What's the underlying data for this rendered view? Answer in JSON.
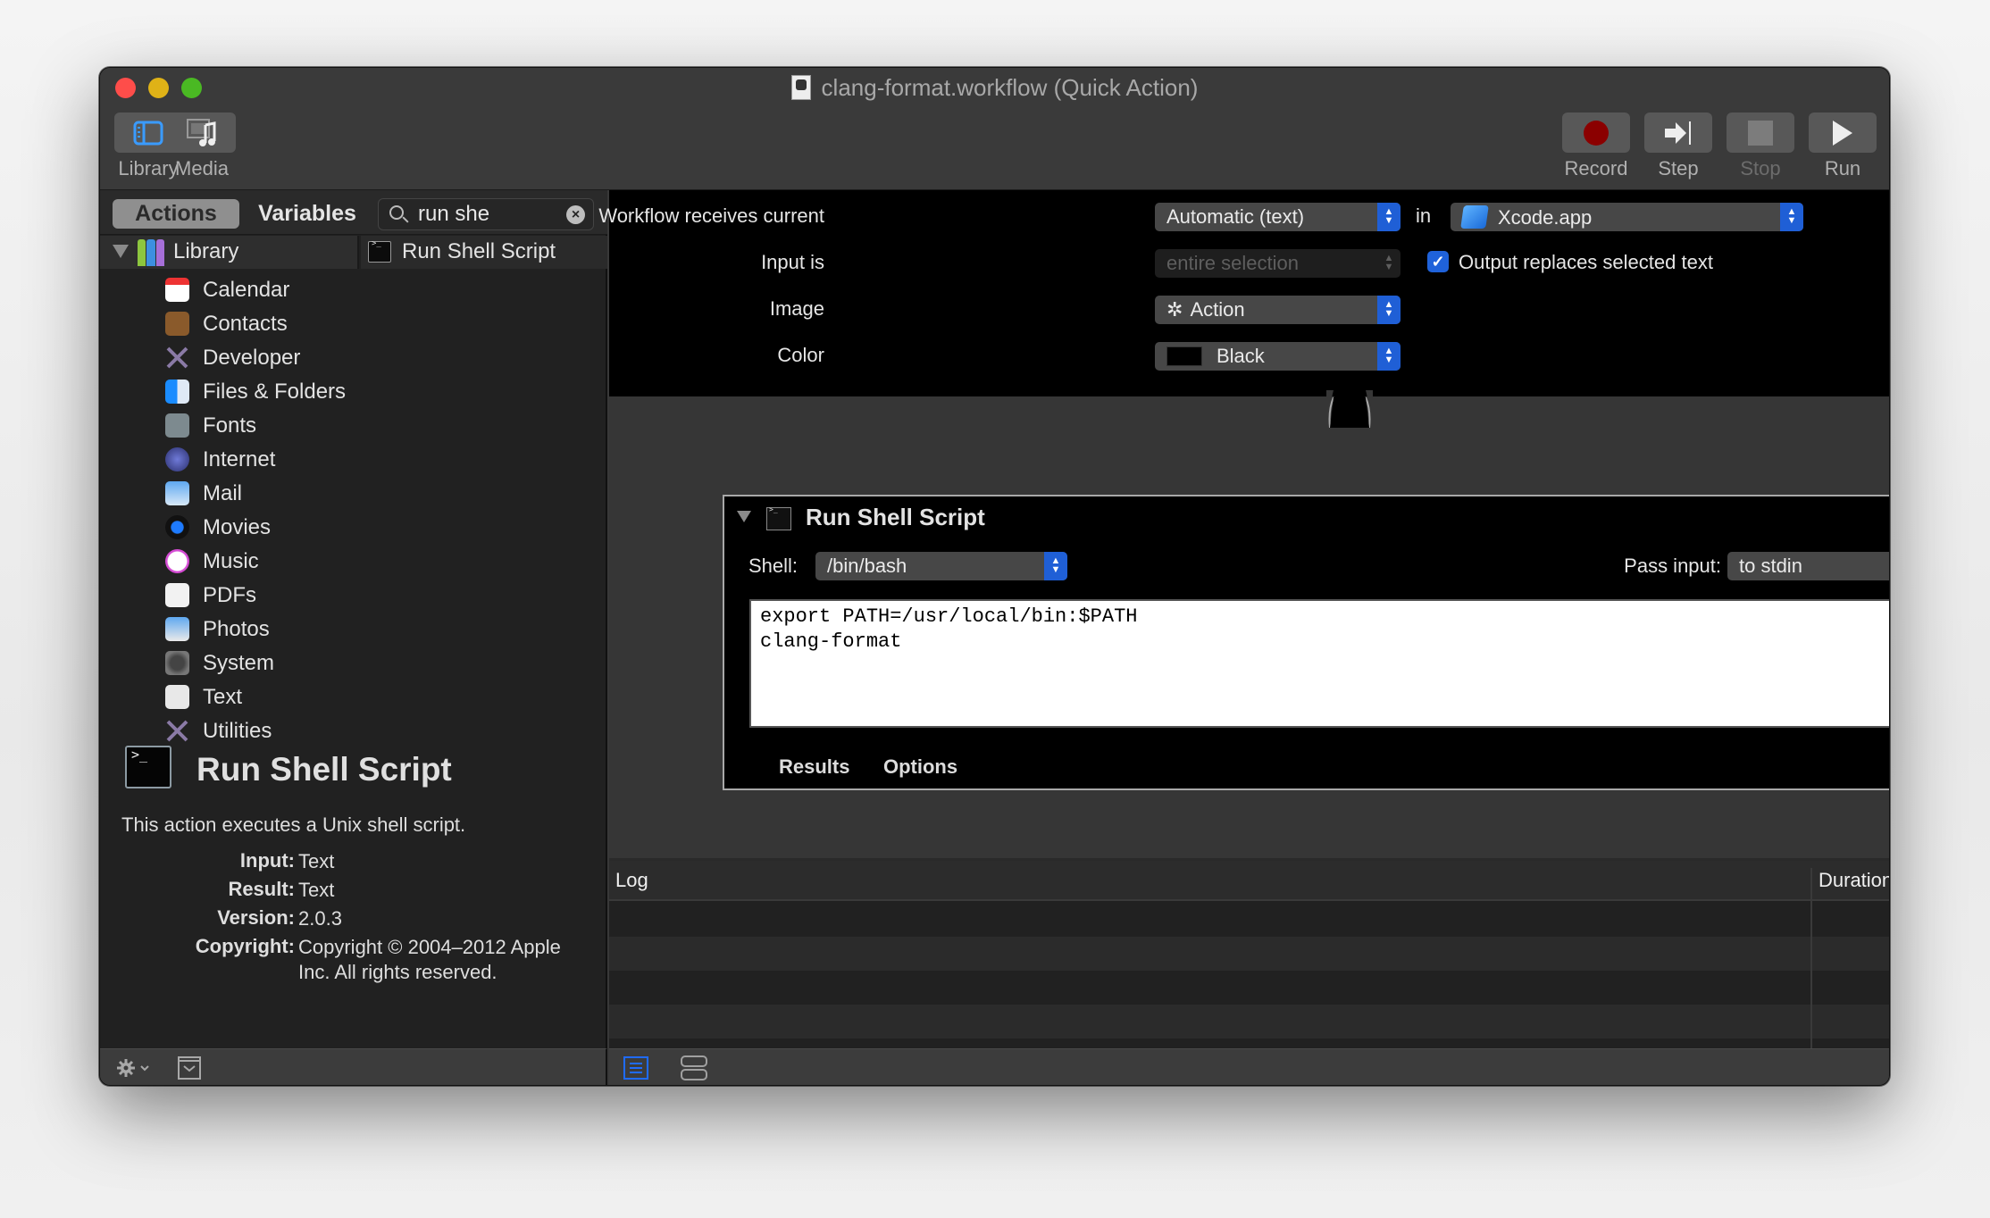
{
  "window": {
    "title": "clang-format.workflow (Quick Action)"
  },
  "toolbar": {
    "left": [
      {
        "label": "Library",
        "icon": "library-sidebar-icon"
      },
      {
        "label": "Media",
        "icon": "media-icon"
      }
    ],
    "right": [
      {
        "label": "Record",
        "icon": "record-icon",
        "enabled": true
      },
      {
        "label": "Step",
        "icon": "step-icon",
        "enabled": true
      },
      {
        "label": "Stop",
        "icon": "stop-icon",
        "enabled": false
      },
      {
        "label": "Run",
        "icon": "run-icon",
        "enabled": true
      }
    ]
  },
  "library_panel": {
    "tabs": {
      "actions": "Actions",
      "variables": "Variables"
    },
    "search": {
      "value": "run she",
      "placeholder": ""
    },
    "library_header": "Library",
    "categories": [
      {
        "label": "Calendar",
        "icon": "calendar-icon"
      },
      {
        "label": "Contacts",
        "icon": "contacts-icon"
      },
      {
        "label": "Developer",
        "icon": "developer-tools-icon"
      },
      {
        "label": "Files & Folders",
        "icon": "finder-icon"
      },
      {
        "label": "Fonts",
        "icon": "fonts-icon"
      },
      {
        "label": "Internet",
        "icon": "internet-globe-icon"
      },
      {
        "label": "Mail",
        "icon": "mail-icon"
      },
      {
        "label": "Movies",
        "icon": "quicktime-icon"
      },
      {
        "label": "Music",
        "icon": "music-icon"
      },
      {
        "label": "PDFs",
        "icon": "pdf-icon"
      },
      {
        "label": "Photos",
        "icon": "photos-icon"
      },
      {
        "label": "System",
        "icon": "system-icon"
      },
      {
        "label": "Text",
        "icon": "text-icon"
      },
      {
        "label": "Utilities",
        "icon": "utilities-icon"
      }
    ],
    "results": [
      {
        "label": "Run Shell Script",
        "icon": "terminal-icon"
      }
    ],
    "description": {
      "title": "Run Shell Script",
      "summary": "This action executes a Unix shell script.",
      "meta": [
        {
          "key": "Input:",
          "value": "Text"
        },
        {
          "key": "Result:",
          "value": "Text"
        },
        {
          "key": "Version:",
          "value": "2.0.3"
        },
        {
          "key": "Copyright:",
          "value": "Copyright © 2004–2012 Apple Inc.  All rights reserved."
        }
      ]
    }
  },
  "workflow": {
    "receives_label": "Workflow receives current",
    "receives_value": "Automatic (text)",
    "in_label": "in",
    "app_value": "Xcode.app",
    "input_is_label": "Input is",
    "input_is_value": "entire selection",
    "output_replaces_label": "Output replaces selected text",
    "output_replaces_checked": true,
    "image_label": "Image",
    "image_value": "Action",
    "color_label": "Color",
    "color_value": "Black",
    "color_swatch": "#000000"
  },
  "action": {
    "title": "Run Shell Script",
    "close_glyph": "×",
    "shell_label": "Shell:",
    "shell_value": "/bin/bash",
    "pass_input_label": "Pass input:",
    "pass_input_value": "to stdin",
    "script": "export PATH=/usr/local/bin:$PATH\nclang-format",
    "tabs": [
      "Results",
      "Options"
    ]
  },
  "log": {
    "columns": [
      "Log",
      "Duration"
    ],
    "rows": []
  },
  "colors": {
    "accent": "#1f62da",
    "record": "#8b0000"
  }
}
